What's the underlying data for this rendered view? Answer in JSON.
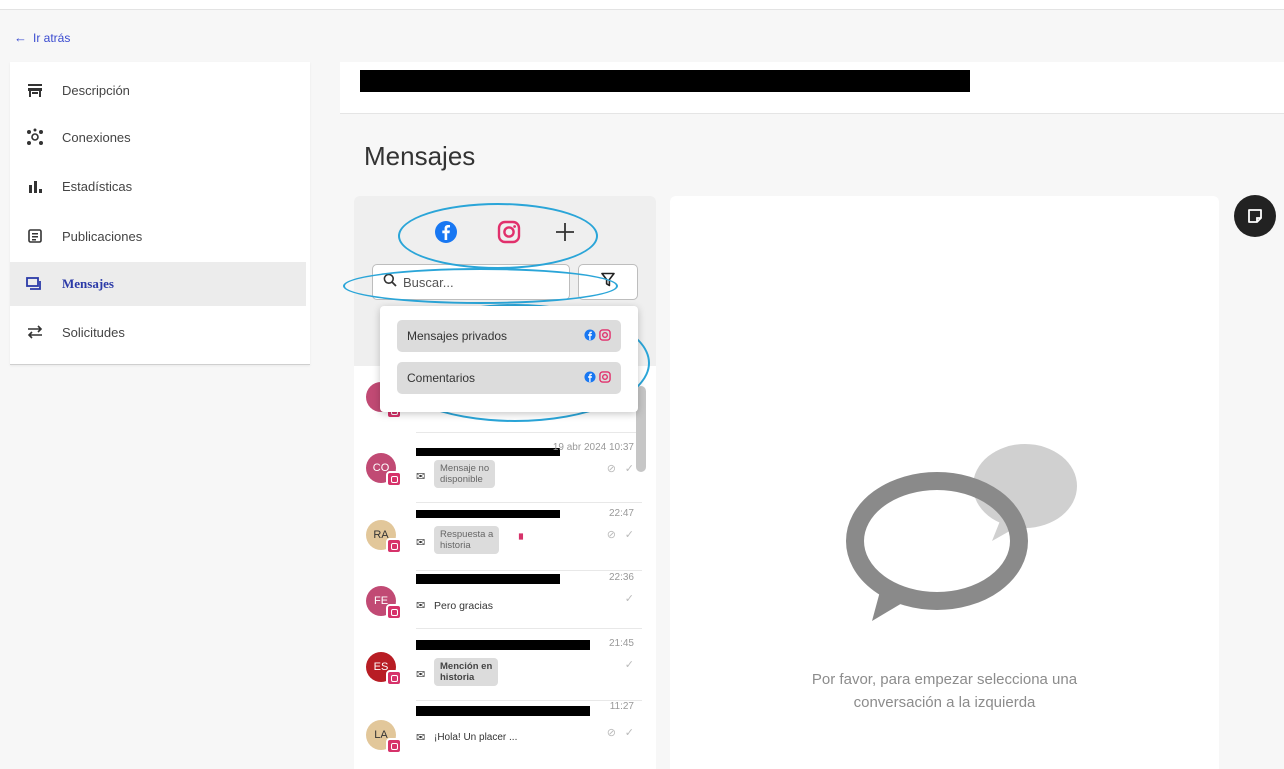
{
  "nav": {
    "back_label": "Ir atrás"
  },
  "sidebar": {
    "items": [
      {
        "label": "Descripción",
        "icon": "store-icon",
        "active": false
      },
      {
        "label": "Conexiones",
        "icon": "network-icon",
        "active": false
      },
      {
        "label": "Estadísticas",
        "icon": "bar-chart-icon",
        "active": false
      },
      {
        "label": "Publicaciones",
        "icon": "document-icon",
        "active": false
      },
      {
        "label": "Mensajes",
        "icon": "chat-icon",
        "active": true
      },
      {
        "label": "Solicitudes",
        "icon": "swap-arrows-icon",
        "active": false
      }
    ]
  },
  "page": {
    "title": "Mensajes"
  },
  "networks": [
    {
      "name": "facebook-icon",
      "color": "#1877f2"
    },
    {
      "name": "instagram-icon",
      "color": "#e1306c"
    },
    {
      "name": "add-icon",
      "color": "#333333"
    }
  ],
  "search": {
    "placeholder": "Buscar..."
  },
  "filter_menu": {
    "items": [
      {
        "label": "Mensajes privados"
      },
      {
        "label": "Comentarios"
      }
    ]
  },
  "conversations": [
    {
      "initials": "CO",
      "color": "#c14a74",
      "time": "19 abr 2024 10:37",
      "tag": "Mensaje no disponible",
      "tag_lines": [
        "Mensaje no",
        "disponible"
      ],
      "status": "✓",
      "hidden": true
    },
    {
      "initials": "RA",
      "color": "#e2c79a",
      "time": "22:47",
      "tag": "Respuesta a historia",
      "tag_lines": [
        "Respuesta a",
        "historia"
      ],
      "status": "✓",
      "hidden": true
    },
    {
      "initials": "FE",
      "color": "#c14a74",
      "time": "22:36",
      "text": "Pero gracias",
      "status": "✓"
    },
    {
      "initials": "ES",
      "color": "#b81d24",
      "time": "21:45",
      "tag": "Mención en historia",
      "tag_lines": [
        "Mención en",
        "historia"
      ],
      "status": "✓"
    },
    {
      "initials": "LA",
      "color": "#e2c79a",
      "time": "11:27",
      "text": "¡Hola! Un placer ...",
      "status": "✓",
      "hidden": true
    }
  ],
  "empty_state": {
    "line1": "Por favor, para empezar selecciona una",
    "line2": "conversación a la izquierda"
  },
  "colors": {
    "accent": "#2b3aa8",
    "highlight": "#2aa5d8",
    "facebook": "#1877f2",
    "instagram": "#e1306c"
  }
}
